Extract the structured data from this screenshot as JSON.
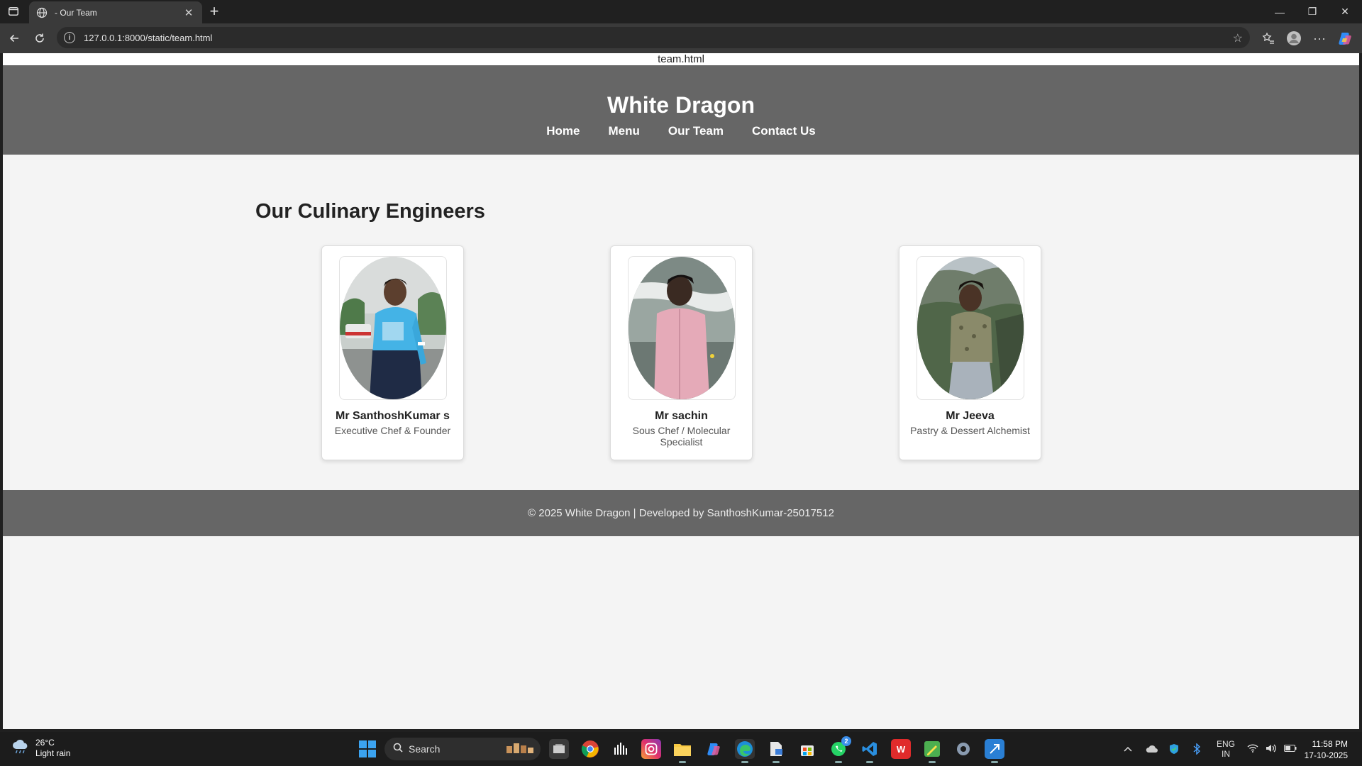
{
  "browser": {
    "tab_title": "- Our Team",
    "url": "127.0.0.1:8000/static/team.html"
  },
  "page": {
    "file_label": "team.html",
    "site_title": "White Dragon",
    "nav": [
      "Home",
      "Menu",
      "Our Team",
      "Contact Us"
    ],
    "section_title": "Our Culinary Engineers",
    "team": [
      {
        "name": "Mr SanthoshKumar s",
        "role": "Executive Chef & Founder"
      },
      {
        "name": "Mr sachin",
        "role": "Sous Chef / Molecular Specialist"
      },
      {
        "name": "Mr Jeeva",
        "role": "Pastry & Dessert Alchemist"
      }
    ],
    "footer": "© 2025 White Dragon | Developed by SanthoshKumar-25017512"
  },
  "taskbar": {
    "weather_temp": "26°C",
    "weather_desc": "Light rain",
    "search_label": "Search",
    "whatsapp_badge": "2",
    "lang_top": "ENG",
    "lang_bottom": "IN",
    "time": "11:58 PM",
    "date": "17-10-2025"
  }
}
